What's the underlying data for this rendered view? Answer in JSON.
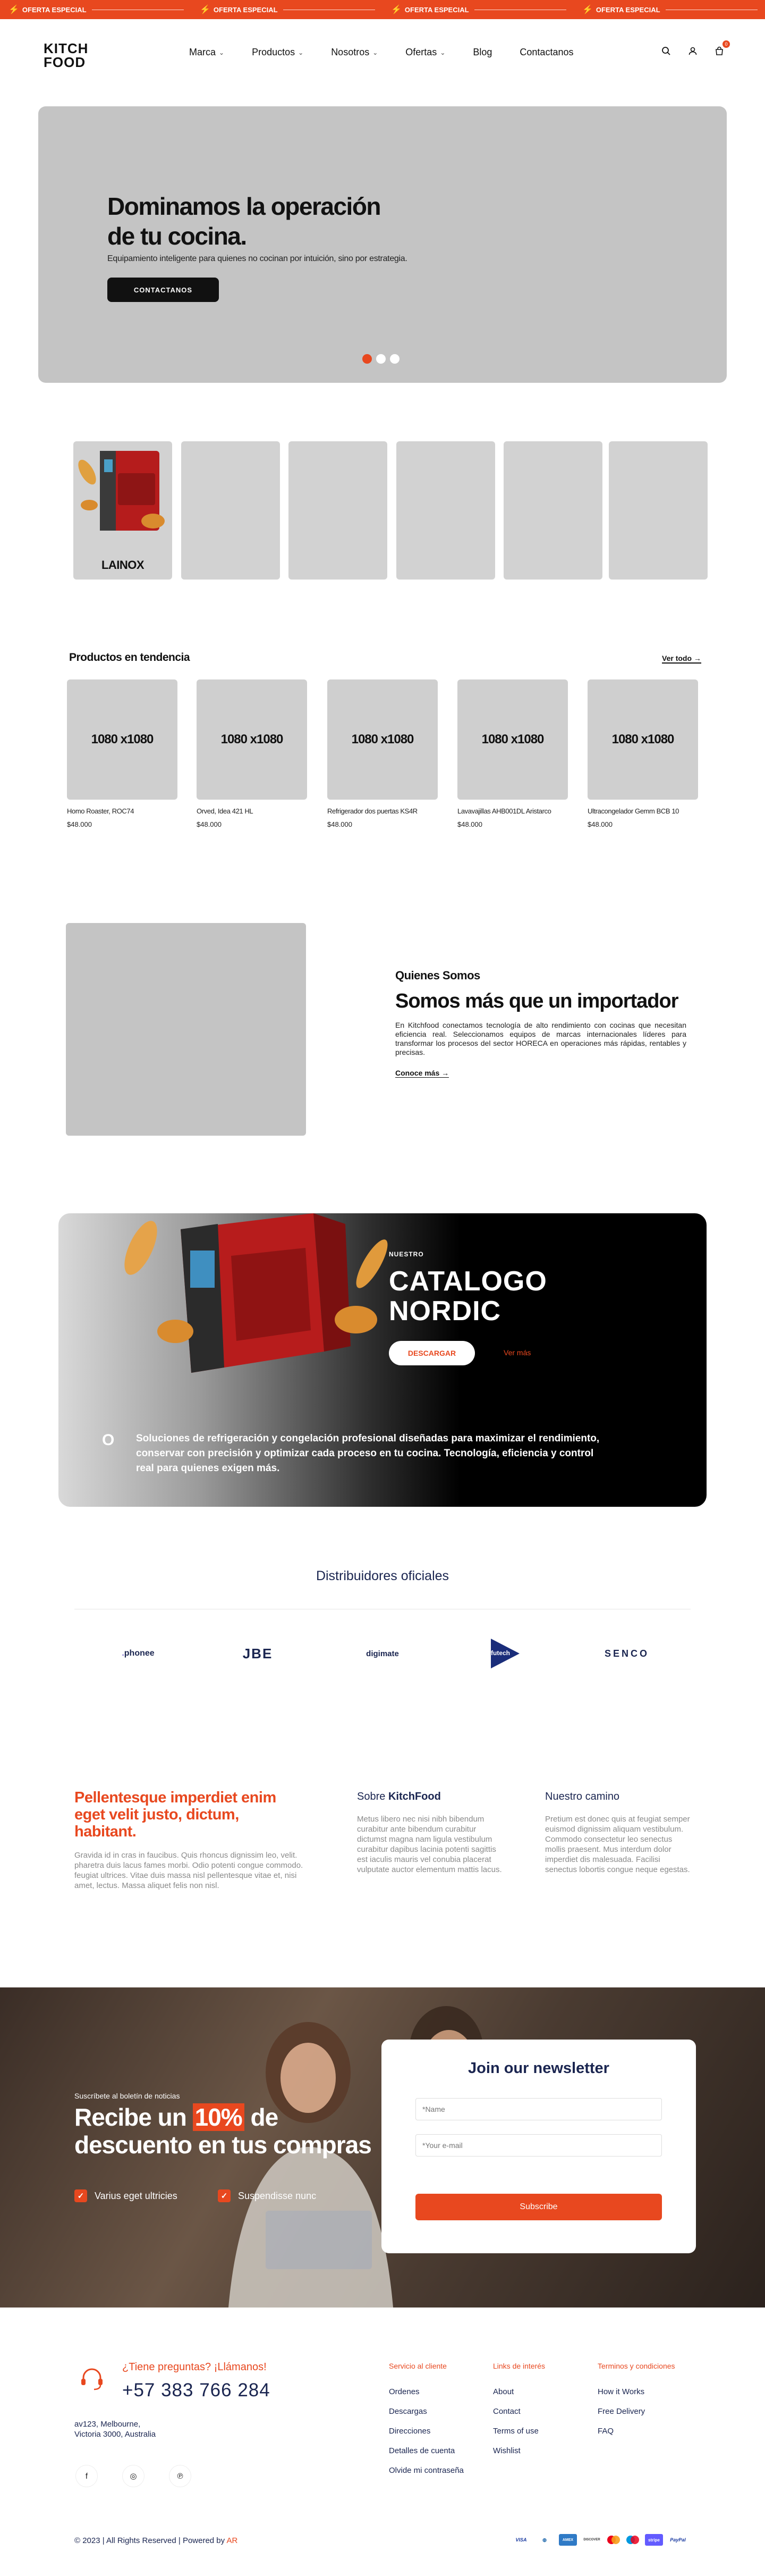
{
  "colors": {
    "accent": "#e8481f",
    "navy": "#1a2550"
  },
  "topbar": {
    "offers": [
      "OFERTA ESPECIAL",
      "OFERTA ESPECIAL",
      "OFERTA ESPECIAL",
      "OFERTA ESPECIAL"
    ]
  },
  "header": {
    "logo_top": "KITCH",
    "logo_bottom": "FOOD",
    "nav": [
      {
        "label": "Marca",
        "dropdown": true
      },
      {
        "label": "Productos",
        "dropdown": true
      },
      {
        "label": "Nosotros",
        "dropdown": true
      },
      {
        "label": "Ofertas",
        "dropdown": true
      },
      {
        "label": "Blog",
        "dropdown": false
      },
      {
        "label": "Contactanos",
        "dropdown": false
      }
    ],
    "icons": [
      "search-icon",
      "user-icon",
      "cart-icon"
    ],
    "cart_count": "0"
  },
  "hero": {
    "title": "Dominamos la operación de tu cocina.",
    "subtitle": "Equipamiento inteligente para quienes no cocinan por intuición, sino por estrategia.",
    "cta": "CONTACTANOS",
    "slides": 3,
    "active_slide": 0
  },
  "brands": [
    {
      "label": "LAINOX"
    },
    {
      "label": ""
    },
    {
      "label": ""
    },
    {
      "label": ""
    },
    {
      "label": ""
    },
    {
      "label": ""
    }
  ],
  "trending": {
    "title": "Productos en tendencia",
    "see_all": "Ver todo →",
    "products": [
      {
        "img": "1080 x1080",
        "name": "Homo Roaster, ROC74",
        "price": "$48.000"
      },
      {
        "img": "1080 x1080",
        "name": "Orved, Idea 421 HL",
        "price": "$48.000"
      },
      {
        "img": "1080 x1080",
        "name": "Refrigerador dos puertas KS4R",
        "price": "$48.000"
      },
      {
        "img": "1080 x1080",
        "name": "Lavavajillas AHB001DL Aristarco",
        "price": "$48.000"
      },
      {
        "img": "1080 x1080",
        "name": "Ultracongelador Gemm BCB 10",
        "price": "$48.000"
      }
    ]
  },
  "about": {
    "eyebrow": "Quienes Somos",
    "title": "Somos más que un importador",
    "text": "En Kitchfood conectamos tecnología de alto rendimiento con cocinas que necesitan eficiencia real. Seleccionamos equipos de marcas internacionales líderes para transformar los procesos del sector HORECA en operaciones más rápidas, rentables y precisas.",
    "link": "Conoce más →"
  },
  "catalog": {
    "eyebrow": "NUESTRO",
    "title_1": "CATALOGO",
    "title_2": "NORDIC",
    "download": "DESCARGAR",
    "more": "Ver más",
    "lead": "O",
    "desc_1": "Soluciones de refrigeración y congelación profesional diseñadas para maximizar el rendimiento,",
    "desc_2": "conservar con precisión y optimizar cada proceso en tu cocina. Tecnología, eficiencia y control",
    "desc_3": "real para quienes exigen más."
  },
  "distributors": {
    "title": "Distribuidores oficiales",
    "logos": [
      "phonee",
      "JBE",
      "digimate",
      "futech",
      "SENCO"
    ]
  },
  "info": {
    "title": "Pellentesque imperdiet enim eget velit justo, dictum, habitant.",
    "text": "Gravida id in cras in faucibus. Quis rhoncus dignissim leo, velit. pharetra duis lacus fames morbi. Odio potenti congue commodo. feugiat ultrices. Vitae duis massa nisl pellentesque vitae et, nisi amet, lectus. Massa aliquet felis non nisl.",
    "col2_head_a": "Sobre ",
    "col2_head_b": "KitchFood",
    "col2_text": "Metus libero nec nisi nibh bibendum curabitur ante bibendum curabitur dictumst magna nam ligula vestibulum curabitur dapibus lacinia potenti sagittis est iaculis mauris vel conubia placerat vulputate auctor elementum mattis lacus.",
    "col3_head": "Nuestro camino",
    "col3_text": "Pretium est donec quis at feugiat semper euismod dignissim aliquam vestibulum. Commodo consectetur leo senectus mollis praesent. Mus interdum dolor imperdiet dis malesuada. Facilisi senectus lobortis congue neque egestas."
  },
  "newsletter": {
    "eyebrow": "Suscríbete al boletín de noticias",
    "title_pre": "Recibe un ",
    "title_hl": "10%",
    "title_post": " de descuento en tus compras",
    "checks": [
      "Varius eget ultricies",
      "Suspendisse nunc"
    ],
    "card_title": "Join our newsletter",
    "name_ph": "*Name",
    "email_ph": "*Your e-mail",
    "button": "Subscribe"
  },
  "footer": {
    "ask": "¿Tiene preguntas? ¡Llámanos!",
    "phone": "+57 383 766 284",
    "addr_1": "av123, Melbourne,",
    "addr_2": "Victoria 3000, Australia",
    "social": [
      "facebook-icon",
      "instagram-icon",
      "pinterest-icon"
    ],
    "col1_title": "Servicio al cliente",
    "col1": [
      "Ordenes",
      "Descargas",
      "Direcciones",
      "Detalles de cuenta",
      "Olvide mi contraseña"
    ],
    "col2_title": "Links de interés",
    "col2": [
      "About",
      "Contact",
      "Terms of use",
      "Wishlist"
    ],
    "col3_title": "Terminos y condiciones",
    "col3": [
      "How it Works",
      "Free Delivery",
      "FAQ"
    ],
    "copy_pre": "© 2023 | All Rights Reserved | Powered by ",
    "copy_ar": "AR",
    "payments": [
      "VISA",
      "Diners",
      "AMEX",
      "DISCOVER",
      "MC",
      "Maestro",
      "stripe",
      "PayPal"
    ]
  }
}
